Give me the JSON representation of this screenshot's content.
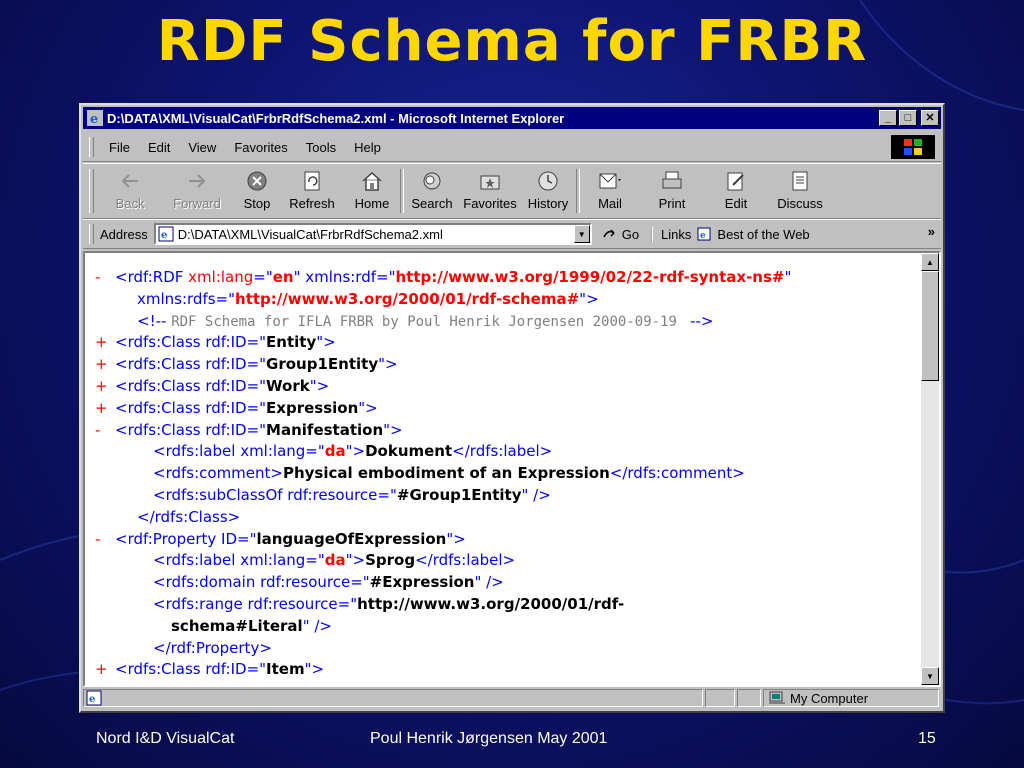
{
  "slide": {
    "title": "RDF Schema for FRBR",
    "footer_left": "Nord I&D VisualCat",
    "footer_center": "Poul Henrik Jørgensen May 2001",
    "footer_right": "15"
  },
  "window": {
    "title": "D:\\DATA\\XML\\VisualCat\\FrbrRdfSchema2.xml - Microsoft Internet Explorer",
    "minimize": "_",
    "maximize": "□",
    "close": "✕"
  },
  "menu": [
    "File",
    "Edit",
    "View",
    "Favorites",
    "Tools",
    "Help"
  ],
  "toolbar": [
    {
      "label": "Back",
      "icon": "back-arrow-icon",
      "disabled": true
    },
    {
      "label": "Forward",
      "icon": "forward-arrow-icon",
      "disabled": true
    },
    {
      "label": "Stop",
      "icon": "stop-icon"
    },
    {
      "label": "Refresh",
      "icon": "refresh-icon"
    },
    {
      "label": "Home",
      "icon": "home-icon"
    },
    {
      "label": "Search",
      "icon": "search-icon"
    },
    {
      "label": "Favorites",
      "icon": "favorites-icon"
    },
    {
      "label": "History",
      "icon": "history-icon"
    },
    {
      "label": "Mail",
      "icon": "mail-icon"
    },
    {
      "label": "Print",
      "icon": "print-icon"
    },
    {
      "label": "Edit",
      "icon": "edit-icon"
    },
    {
      "label": "Discuss",
      "icon": "discuss-icon"
    }
  ],
  "address": {
    "label": "Address",
    "value": "D:\\DATA\\XML\\VisualCat\\FrbrRdfSchema2.xml",
    "go": "Go",
    "links": "Links",
    "best_of_web": "Best of the Web",
    "more": "»"
  },
  "xml_lines": [
    {
      "toggle": "-",
      "indent": 0,
      "html": "&lt;rdf:RDF <span class='attr'>xml:lang</span>=\"<span class='url'>en</span>\" xmlns:rdf=\"<span class='url'>http://www.w3.org/1999/02/22-rdf-syntax-ns#</span>\""
    },
    {
      "toggle": "",
      "indent": 1,
      "html": "xmlns:rdfs=\"<span class='url'>http://www.w3.org/2000/01/rdf-schema#</span>\"&gt;"
    },
    {
      "toggle": "",
      "indent": 1,
      "html": "&lt;!-- <span class='cmt'>RDF Schema for IFLA FRBR by Poul Henrik Jorgensen 2000-09-19 </span> --&gt;"
    },
    {
      "toggle": "+",
      "indent": 0,
      "html": "&lt;rdfs:Class rdf:ID=\"<span class='val-str'>Entity</span>\"&gt;"
    },
    {
      "toggle": "+",
      "indent": 0,
      "html": "&lt;rdfs:Class rdf:ID=\"<span class='val-str'>Group1Entity</span>\"&gt;"
    },
    {
      "toggle": "+",
      "indent": 0,
      "html": "&lt;rdfs:Class rdf:ID=\"<span class='val-str'>Work</span>\"&gt;"
    },
    {
      "toggle": "+",
      "indent": 0,
      "html": "&lt;rdfs:Class rdf:ID=\"<span class='val-str'>Expression</span>\"&gt;"
    },
    {
      "toggle": "-",
      "indent": 0,
      "html": "&lt;rdfs:Class rdf:ID=\"<span class='val-str'>Manifestation</span>\"&gt;"
    },
    {
      "toggle": "",
      "indent": 2,
      "html": "&lt;rdfs:label xml:lang=\"<span class='url'>da</span>\"&gt;<span class='txt'>Dokument</span>&lt;/rdfs:label&gt;"
    },
    {
      "toggle": "",
      "indent": 2,
      "html": "&lt;rdfs:comment&gt;<span class='txt'>Physical embodiment of an Expression</span>&lt;/rdfs:comment&gt;"
    },
    {
      "toggle": "",
      "indent": 2,
      "html": "&lt;rdfs:subClassOf rdf:resource=\"<span class='val-str'>#Group1Entity</span>\" /&gt;"
    },
    {
      "toggle": "",
      "indent": 1,
      "html": "&lt;/rdfs:Class&gt;"
    },
    {
      "toggle": "-",
      "indent": 0,
      "html": "&lt;rdf:Property ID=\"<span class='val-str'>languageOfExpression</span>\"&gt;"
    },
    {
      "toggle": "",
      "indent": 2,
      "html": "&lt;rdfs:label xml:lang=\"<span class='url'>da</span>\"&gt;<span class='txt'>Sprog</span>&lt;/rdfs:label&gt;"
    },
    {
      "toggle": "",
      "indent": 2,
      "html": "&lt;rdfs:domain rdf:resource=\"<span class='val-str'>#Expression</span>\" /&gt;"
    },
    {
      "toggle": "",
      "indent": 2,
      "html": "&lt;rdfs:range rdf:resource=\"<span class='val-str'>http://www.w3.org/2000/01/rdf-</span>"
    },
    {
      "toggle": "",
      "indent": 3,
      "html": "<span class='val-str'>schema#Literal</span>\" /&gt;"
    },
    {
      "toggle": "",
      "indent": 2,
      "html": "&lt;/rdf:Property&gt;"
    },
    {
      "toggle": "+",
      "indent": 0,
      "html": "&lt;rdfs:Class rdf:ID=\"<span class='val-str'>Item</span>\"&gt;"
    }
  ],
  "status": {
    "zone": "My Computer"
  },
  "colors": {
    "title": "#ffd700",
    "titlebar": "#000080",
    "tag": "#0000ff",
    "toggle": "#ff0000"
  }
}
